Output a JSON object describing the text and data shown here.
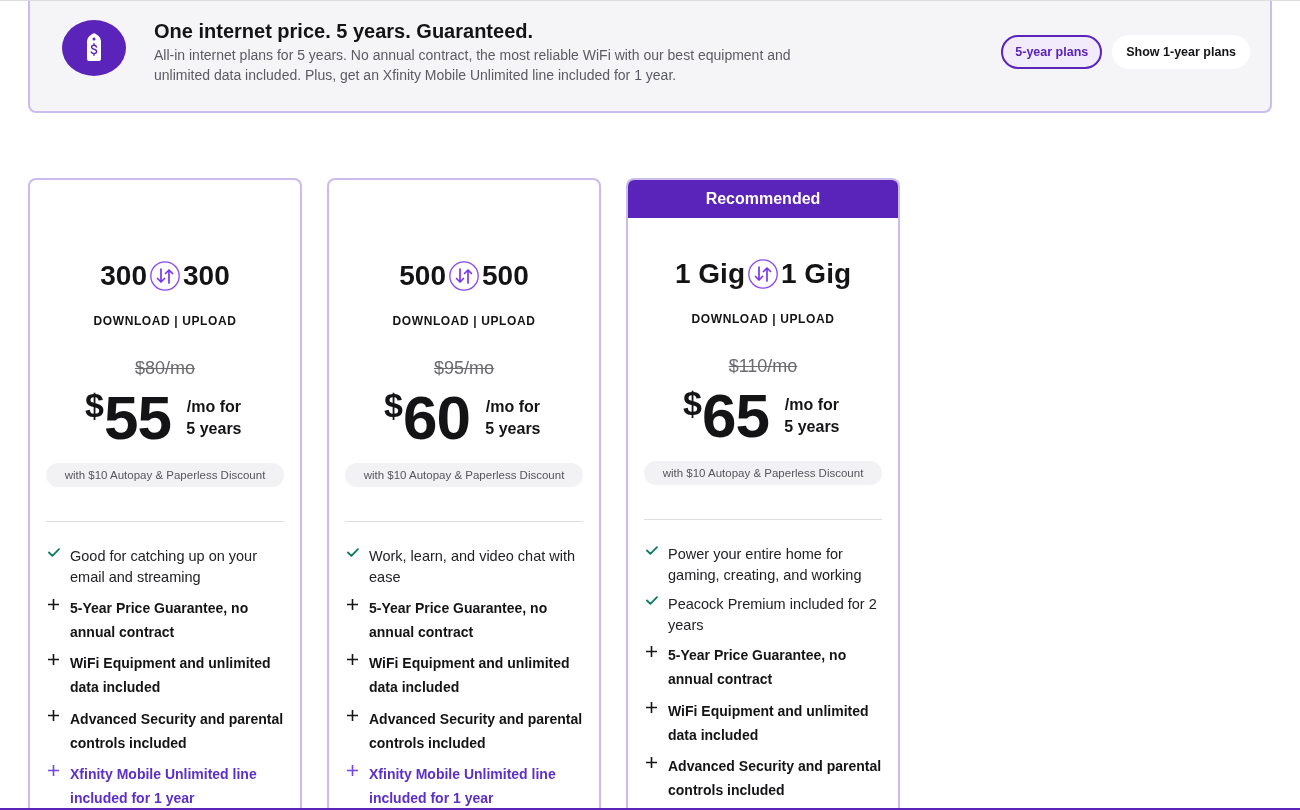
{
  "banner": {
    "title": "One internet price. 5 years. Guaranteed.",
    "description": "All-in internet plans for 5 years. No annual contract, the most reliable WiFi with our best equipment and unlimited data included. Plus, get an Xfinity Mobile Unlimited line included for 1 year.",
    "plan_terms": [
      {
        "label": "5-year plans",
        "selected": true
      },
      {
        "label": "Show 1-year plans",
        "selected": false
      }
    ]
  },
  "plans": [
    {
      "download": "300",
      "upload": "300",
      "speed_caption": "DOWNLOAD | UPLOAD",
      "regular_price": "$80/mo",
      "currency": "$",
      "price": "55",
      "price_terms": "/mo for 5 years",
      "discount": "with $10 Autopay & Paperless Discount",
      "features": [
        {
          "kind": "check",
          "text": "Good for catching up on your email and streaming"
        },
        {
          "kind": "plus",
          "text": "5-Year Price Guarantee, no annual contract"
        },
        {
          "kind": "plus",
          "text": "WiFi Equipment and unlimited data included"
        },
        {
          "kind": "plus",
          "text": "Advanced Security and parental controls included"
        },
        {
          "kind": "promo",
          "text": "Xfinity Mobile Unlimited line included for 1 year"
        }
      ]
    },
    {
      "download": "500",
      "upload": "500",
      "speed_caption": "DOWNLOAD | UPLOAD",
      "regular_price": "$95/mo",
      "currency": "$",
      "price": "60",
      "price_terms": "/mo for 5 years",
      "discount": "with $10 Autopay & Paperless Discount",
      "features": [
        {
          "kind": "check",
          "text": "Work, learn, and video chat with ease"
        },
        {
          "kind": "plus",
          "text": "5-Year Price Guarantee, no annual contract"
        },
        {
          "kind": "plus",
          "text": "WiFi Equipment and unlimited data included"
        },
        {
          "kind": "plus",
          "text": "Advanced Security and parental controls included"
        },
        {
          "kind": "promo",
          "text": "Xfinity Mobile Unlimited line included for 1 year"
        }
      ]
    },
    {
      "badge": "Recommended",
      "download": "1 Gig",
      "upload": "1 Gig",
      "speed_caption": "DOWNLOAD | UPLOAD",
      "regular_price": "$110/mo",
      "currency": "$",
      "price": "65",
      "price_terms": "/mo for 5 years",
      "discount": "with $10 Autopay & Paperless Discount",
      "features": [
        {
          "kind": "check",
          "text": "Power your entire home for gaming, creating, and working"
        },
        {
          "kind": "check",
          "text": "Peacock Premium included for 2 years"
        },
        {
          "kind": "plus",
          "text": "5-Year Price Guarantee, no annual contract"
        },
        {
          "kind": "plus",
          "text": "WiFi Equipment and unlimited data included"
        },
        {
          "kind": "plus",
          "text": "Advanced Security and parental controls included"
        }
      ]
    }
  ]
}
